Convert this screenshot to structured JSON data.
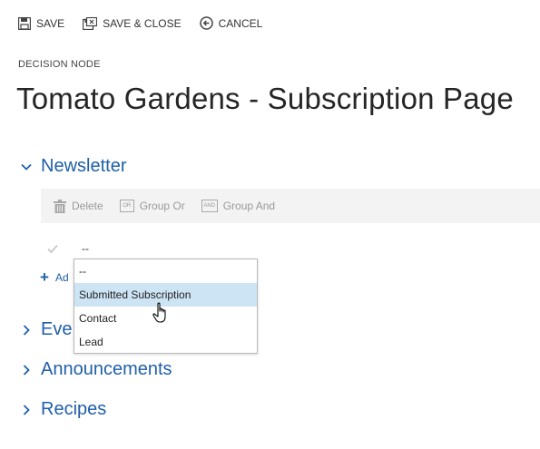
{
  "toolbar": {
    "save_label": "SAVE",
    "save_close_label": "SAVE & CLOSE",
    "cancel_label": "CANCEL"
  },
  "header": {
    "eyebrow": "DECISION NODE",
    "title": "Tomato Gardens - Subscription Page"
  },
  "sections": [
    {
      "label": "Newsletter",
      "expanded": true
    },
    {
      "label": "Eve",
      "expanded": false
    },
    {
      "label": "Announcements",
      "expanded": false
    },
    {
      "label": "Recipes",
      "expanded": false
    }
  ],
  "rulebar": {
    "delete_label": "Delete",
    "group_or_label": "Group Or",
    "group_and_label": "Group And",
    "group_or_badge": "OR",
    "group_and_badge": "AND"
  },
  "condition": {
    "value": "--"
  },
  "add_link": {
    "label": "Ad"
  },
  "dropdown": {
    "options": [
      "--",
      "Submitted Subscription",
      "Contact",
      "Lead"
    ],
    "highlighted_index": 1
  },
  "colors": {
    "accent": "#1f5fa8",
    "highlight": "#cde4f5",
    "rulebar_bg": "#f3f3f3"
  }
}
